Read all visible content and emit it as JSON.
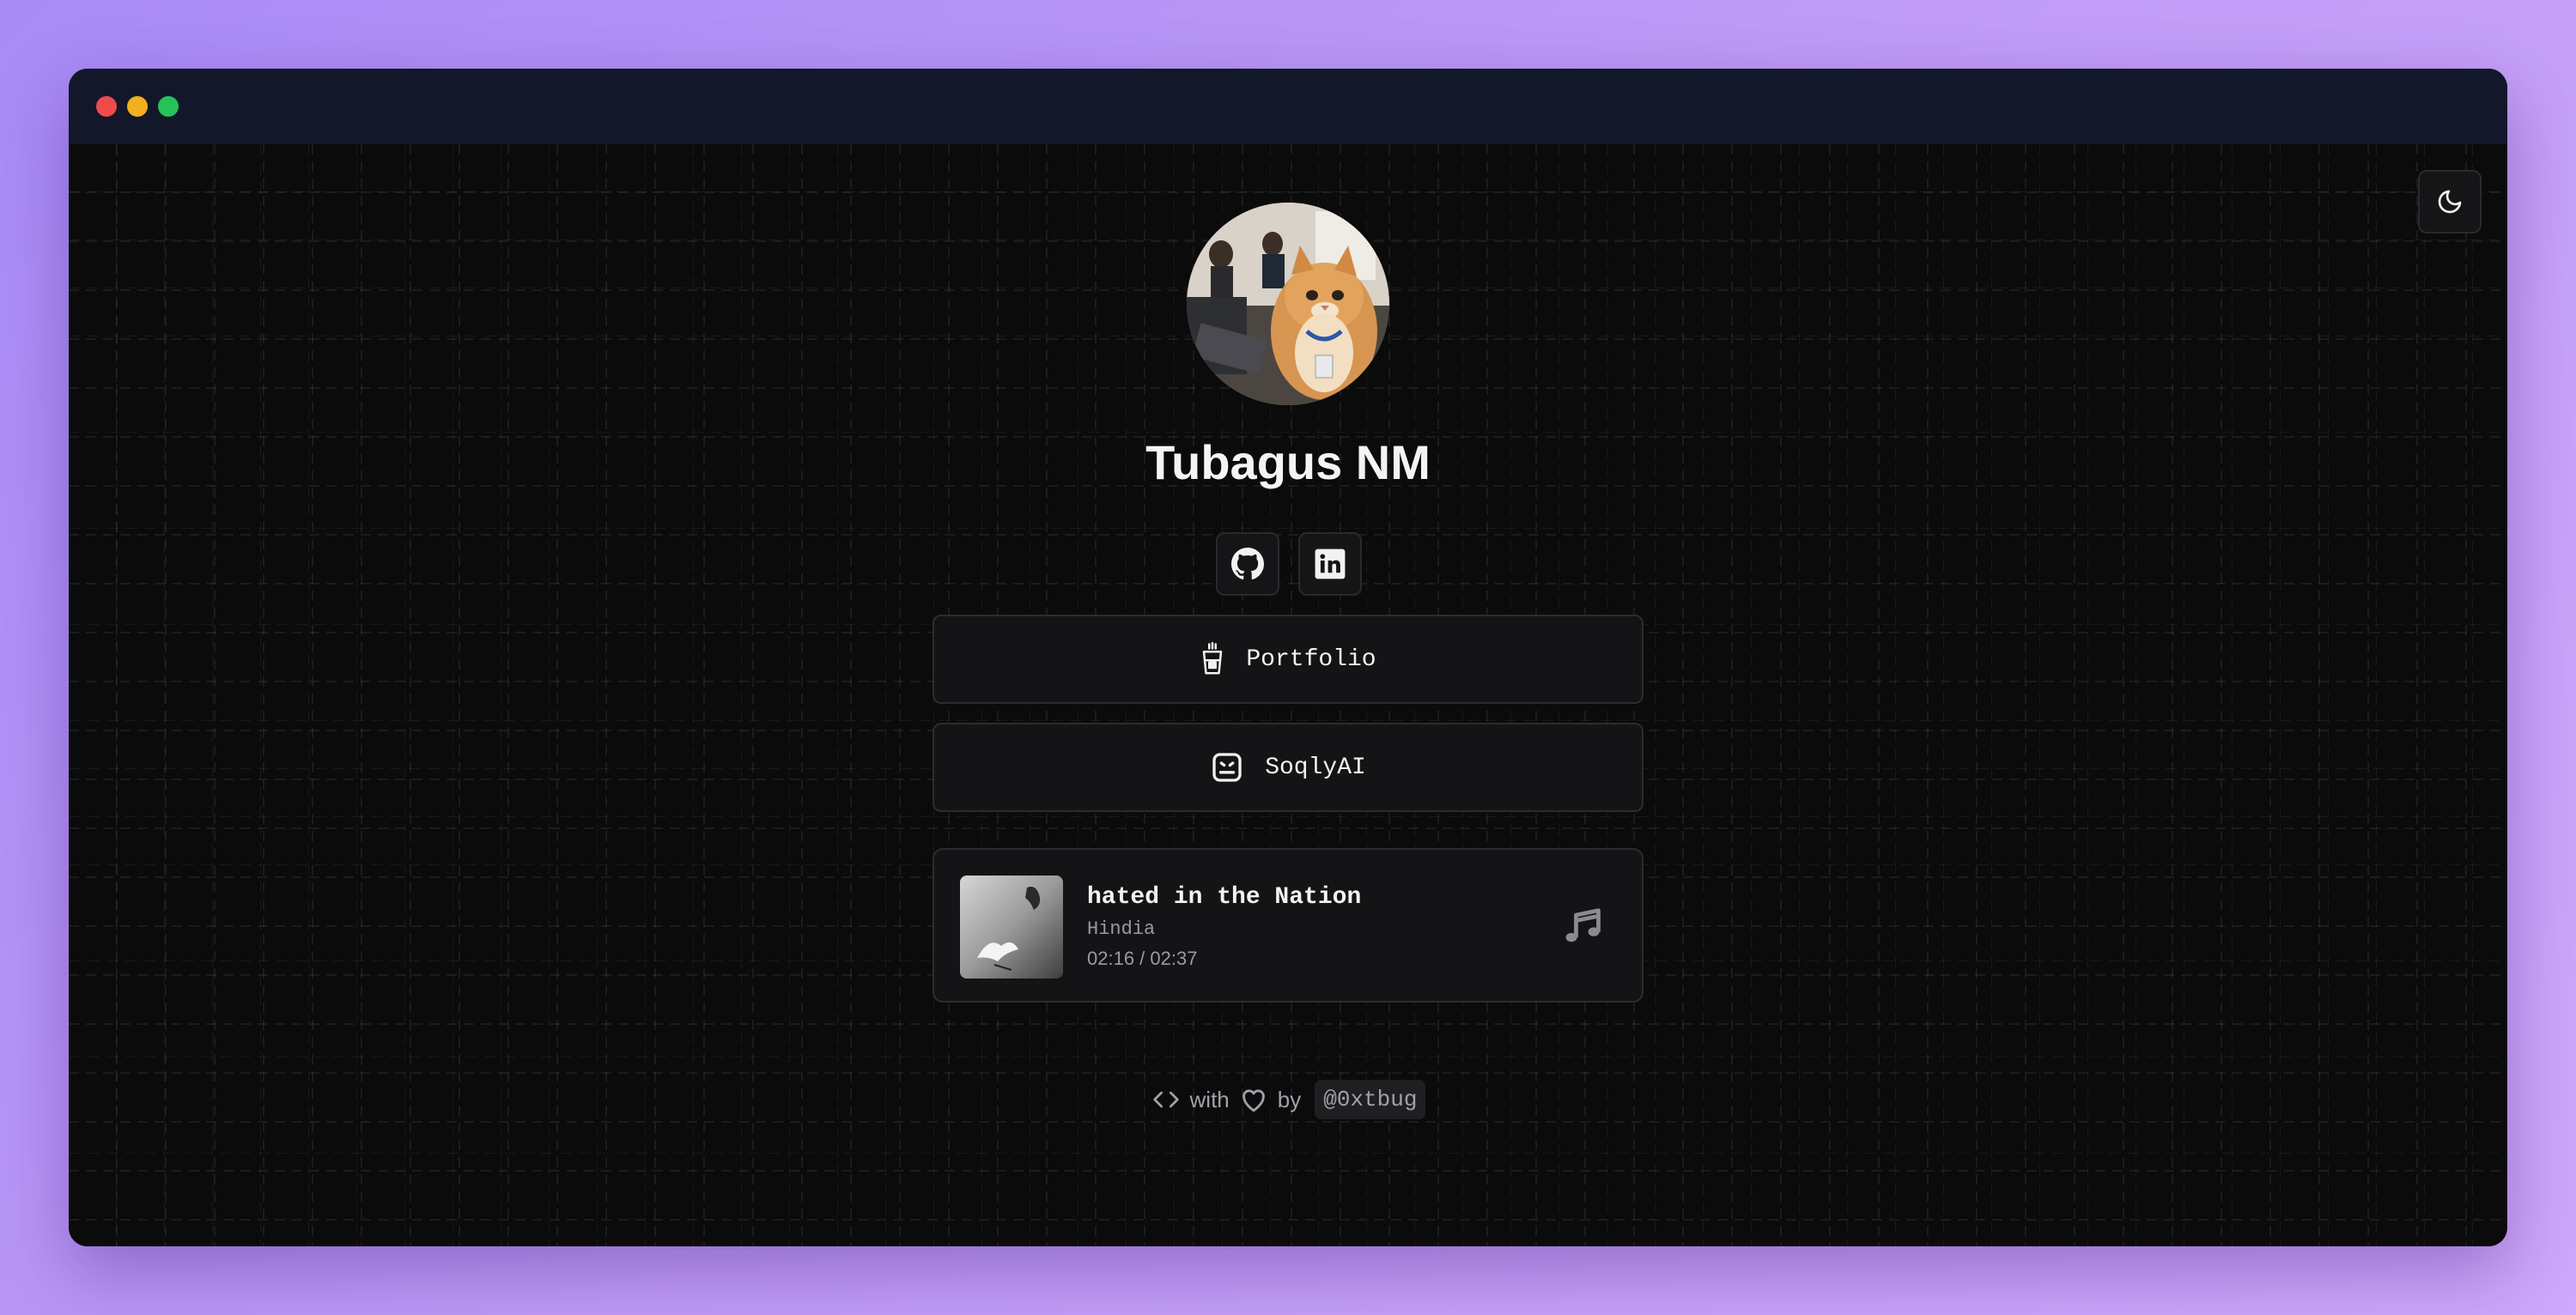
{
  "window": {
    "traffic_lights": [
      "close",
      "minimize",
      "maximize"
    ]
  },
  "theme_toggle": {
    "icon": "moon-icon"
  },
  "profile": {
    "name": "Tubagus NM",
    "avatar_icon": "avatar"
  },
  "social": [
    {
      "icon": "github-icon"
    },
    {
      "icon": "linkedin-icon"
    }
  ],
  "links": [
    {
      "label": "Portfolio",
      "icon": "coffee-cup-icon"
    },
    {
      "label": "SoqlyAI",
      "icon": "bot-icon"
    }
  ],
  "player": {
    "title": "hated in the Nation",
    "artist": "Hindia",
    "time": "02:16 / 02:37",
    "icon": "music-note-icon"
  },
  "footer": {
    "with_text": "with",
    "by_text": "by",
    "handle": "@0xtbug"
  },
  "colors": {
    "background_gradient_start": "#a98bf6",
    "background_gradient_end": "#cda8fb",
    "titlebar": "#121829",
    "content_bg": "#0b0b0c",
    "card_bg": "#141416",
    "text_primary": "#f4f4f5",
    "text_muted": "#a1a1aa"
  }
}
